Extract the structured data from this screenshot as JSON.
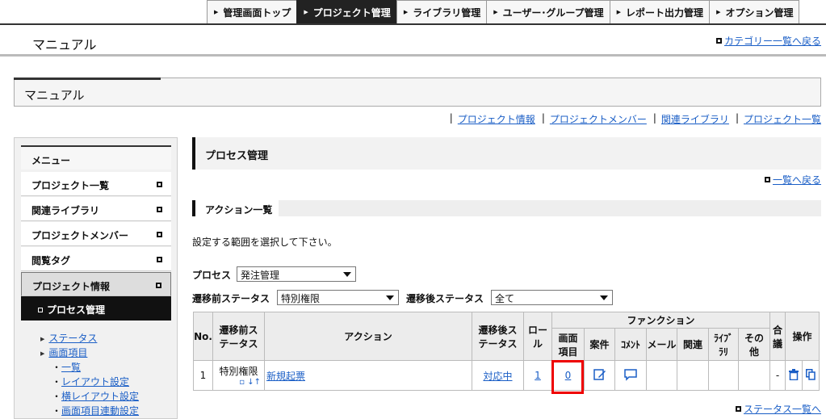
{
  "topnav": [
    "管理画面トップ",
    "プロジェクト管理",
    "ライブラリ管理",
    "ユーザー･グループ管理",
    "レポート出力管理",
    "オプション管理"
  ],
  "header": {
    "title": "マニュアル",
    "back_link": "カテゴリー一覧へ戻る"
  },
  "project": {
    "title": "マニュアル"
  },
  "project_links": [
    "プロジェクト情報",
    "プロジェクトメンバー",
    "関連ライブラリ",
    "プロジェクト一覧"
  ],
  "menu": {
    "heading": "メニュー",
    "items": [
      "プロジェクト一覧",
      "関連ライブラリ",
      "プロジェクトメンバー",
      "閲覧タグ",
      "プロジェクト情報"
    ],
    "current": "プロセス管理",
    "sub": [
      "ステータス",
      "画面項目"
    ],
    "sub2": [
      "一覧",
      "レイアウト設定",
      "横レイアウト設定",
      "画面項目連動設定"
    ]
  },
  "page": {
    "title": "プロセス管理",
    "back_link": "一覧へ戻る",
    "action_list_title": "アクション一覧",
    "instruction": "設定する範囲を選択して下さい。"
  },
  "form": {
    "process_label": "プロセス",
    "process_value": "発注管理",
    "before_label": "遷移前ステータス",
    "before_value": "特別権限",
    "after_label": "遷移後ステータス",
    "after_value": "全て"
  },
  "table": {
    "headers": {
      "no": "No.",
      "before": "遷移前ステータス",
      "action": "アクション",
      "after": "遷移後ステータス",
      "role": "ロール",
      "function": "ファンクション",
      "screen": "画面項目",
      "case": "案件",
      "comment": "ｺﾒﾝﾄ",
      "mail": "メール",
      "related": "関連",
      "library": "ﾗｲﾌﾞﾗﾘ",
      "other": "その他",
      "council": "合議",
      "ops": "操作"
    },
    "rows": [
      {
        "no": "1",
        "before": "特別権限",
        "action": "新規起票",
        "after": "対応中",
        "role": "1",
        "screen": "0",
        "council": "-"
      }
    ]
  },
  "footer": {
    "back_status": "ステータス一覧へ"
  }
}
